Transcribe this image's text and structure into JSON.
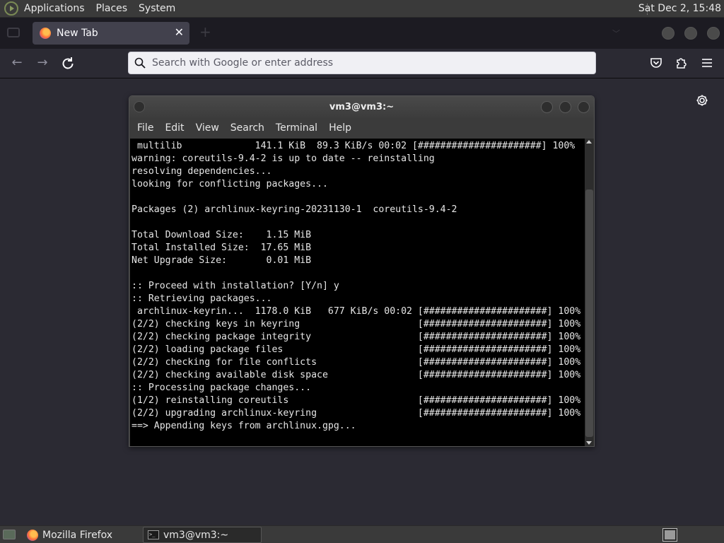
{
  "top_panel": {
    "menus": [
      "Applications",
      "Places",
      "System"
    ],
    "clock": "Sat Dec  2, 15:48"
  },
  "browser": {
    "tab": {
      "label": "New Tab",
      "close": "✕"
    },
    "urlbar": {
      "placeholder": "Search with Google or enter address",
      "value": ""
    }
  },
  "terminal": {
    "title": "vm3@vm3:~",
    "menus": [
      "File",
      "Edit",
      "View",
      "Search",
      "Terminal",
      "Help"
    ],
    "lines": [
      " multilib             141.1 KiB  89.3 KiB/s 00:02 [######################] 100%",
      "warning: coreutils-9.4-2 is up to date -- reinstalling",
      "resolving dependencies...",
      "looking for conflicting packages...",
      "",
      "Packages (2) archlinux-keyring-20231130-1  coreutils-9.4-2",
      "",
      "Total Download Size:    1.15 MiB",
      "Total Installed Size:  17.65 MiB",
      "Net Upgrade Size:       0.01 MiB",
      "",
      ":: Proceed with installation? [Y/n] y",
      ":: Retrieving packages...",
      " archlinux-keyrin...  1178.0 KiB   677 KiB/s 00:02 [######################] 100%",
      "(2/2) checking keys in keyring                     [######################] 100%",
      "(2/2) checking package integrity                   [######################] 100%",
      "(2/2) loading package files                        [######################] 100%",
      "(2/2) checking for file conflicts                  [######################] 100%",
      "(2/2) checking available disk space                [######################] 100%",
      ":: Processing package changes...",
      "(1/2) reinstalling coreutils                       [######################] 100%",
      "(2/2) upgrading archlinux-keyring                  [######################] 100%",
      "==> Appending keys from archlinux.gpg..."
    ]
  },
  "taskbar": {
    "items": [
      {
        "label": "Mozilla Firefox",
        "icon": "firefox-icon"
      },
      {
        "label": "vm3@vm3:~",
        "icon": "terminal-icon"
      }
    ]
  }
}
